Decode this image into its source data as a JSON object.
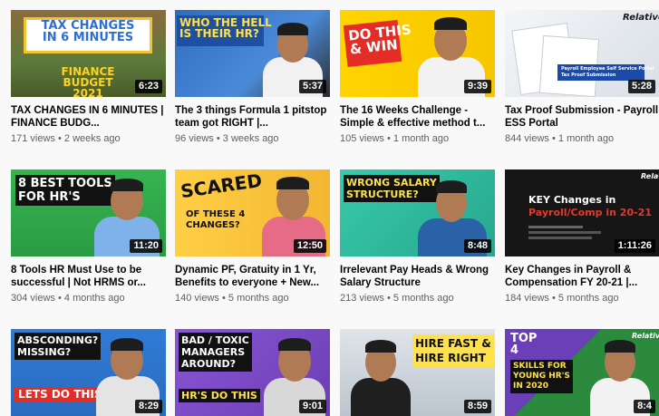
{
  "videos": [
    {
      "title": "TAX CHANGES IN 6 MINUTES | FINANCE BUDG...",
      "views": "171 views",
      "age": "2 weeks ago",
      "duration": "6:23",
      "caption": "TAX CHANGES\nIN 6 MINUTES",
      "sub": "FINANCE BUDGET\n2021",
      "watched": 0
    },
    {
      "title": "The 3 things Formula 1 pitstop team got RIGHT |...",
      "views": "96 views",
      "age": "3 weeks ago",
      "duration": "5:37",
      "caption": "WHO THE HELL\nIS THEIR HR?",
      "sub": "",
      "watched": 0
    },
    {
      "title": "The 16 Weeks Challenge - Simple & effective method t...",
      "views": "105 views",
      "age": "1 month ago",
      "duration": "9:39",
      "caption": "DO THIS\n& WIN",
      "sub": "",
      "watched": 0
    },
    {
      "title": "Tax Proof Submission - Payroll ESS Portal",
      "views": "844 views",
      "age": "1 month ago",
      "duration": "5:28",
      "caption": "Relative",
      "sub": "Payroll Employee Self Service Portal\nTax Proof Submission",
      "watched": 0
    },
    {
      "title": "8 Tools HR Must Use to be successful | Not HRMS or...",
      "views": "304 views",
      "age": "4 months ago",
      "duration": "11:20",
      "caption": "8 BEST TOOLS\nFOR HR'S",
      "sub": "",
      "watched": 0
    },
    {
      "title": "Dynamic PF, Gratuity in 1 Yr, Benefits to everyone + New...",
      "views": "140 views",
      "age": "5 months ago",
      "duration": "12:50",
      "caption": "SCARED",
      "sub": "OF THESE 4\nCHANGES?",
      "watched": 0
    },
    {
      "title": "Irrelevant Pay Heads & Wrong Salary Structure",
      "views": "213 views",
      "age": "5 months ago",
      "duration": "8:48",
      "caption": "WRONG SALARY\nSTRUCTURE?",
      "sub": "",
      "watched": 0
    },
    {
      "title": "Key Changes in Payroll & Compensation FY 20-21 |...",
      "views": "184 views",
      "age": "5 months ago",
      "duration": "1:11:26",
      "caption": "KEY Changes in",
      "sub": "Payroll/Comp in 20-21",
      "watched": 0
    },
    {
      "title": "",
      "views": "",
      "age": "",
      "duration": "8:29",
      "caption": "ABSCONDING?\nMISSING?",
      "sub": "LETS DO THIS!",
      "watched": 0
    },
    {
      "title": "",
      "views": "",
      "age": "",
      "duration": "9:01",
      "caption": "BAD / TOXIC\nMANAGERS\nAROUND?",
      "sub": "HR'S DO THIS",
      "watched": 0
    },
    {
      "title": "",
      "views": "",
      "age": "",
      "duration": "8:59",
      "caption": "HIRE FAST &\nHIRE RIGHT",
      "sub": "",
      "watched": 0
    },
    {
      "title": "",
      "views": "",
      "age": "",
      "duration": "8:4",
      "caption": "TOP\n4",
      "sub": "SKILLS FOR\nYOUNG HR'S\nIN 2020",
      "watched": 0
    }
  ],
  "separator": "•",
  "colors": {
    "accent": "#ff0000",
    "meta": "#606060",
    "title": "#030303"
  },
  "extra_captions": {
    "relative_small": "Relative",
    "relative_small_b": "Relative"
  }
}
